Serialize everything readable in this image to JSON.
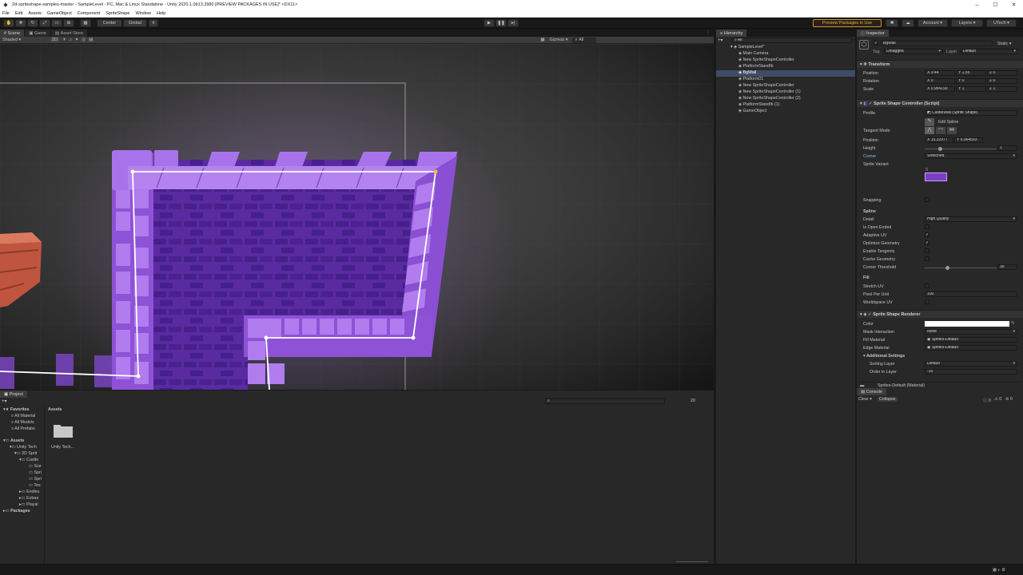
{
  "window": {
    "title": "2d-spriteshape-samples-master - SampleLevel - PC, Mac & Linux Standalone - Unity 2020.1.0b13.3980 [PREVIEW PACKAGES IN USE]* <DX11>",
    "controls": {
      "minimize": "–",
      "maximize": "☐",
      "close": "✕"
    }
  },
  "menu": [
    "File",
    "Edit",
    "Assets",
    "GameObject",
    "Component",
    "SpriteShape",
    "Window",
    "Help"
  ],
  "toolbar": {
    "center": "Center",
    "global": "Global",
    "preview_packages": "Preview Packages in Use",
    "account": "Account",
    "layers": "Layers",
    "layout": "UTech"
  },
  "scene_tabs": [
    "Scene",
    "Game",
    "Asset Store"
  ],
  "scene_bar": {
    "shading": "Shaded",
    "mode_2d": "2D",
    "gizmos": "Gizmos",
    "search": "All"
  },
  "hierarchy": {
    "tab": "Hierarchy",
    "search": "All",
    "items": [
      {
        "label": "SampleLevel*",
        "depth": 0
      },
      {
        "label": "Main Camera",
        "depth": 1
      },
      {
        "label": "New SpriteShapeController",
        "depth": 1
      },
      {
        "label": "PlatformStandfb",
        "depth": 1
      },
      {
        "label": "BgWall",
        "depth": 1,
        "selected": true
      },
      {
        "label": "Platform01",
        "depth": 1
      },
      {
        "label": "New SpriteShapeController",
        "depth": 1
      },
      {
        "label": "New SpriteShapeController (1)",
        "depth": 1
      },
      {
        "label": "New SpriteShapeController (2)",
        "depth": 1
      },
      {
        "label": "PlatformStandfb (1)",
        "depth": 1
      },
      {
        "label": "GameObject",
        "depth": 1
      }
    ]
  },
  "inspector": {
    "tab": "Inspector",
    "object_name": "BgWall",
    "static_label": "Static",
    "tag_label": "Tag",
    "tag_value": "Untagged",
    "layer_label": "Layer",
    "layer_value": "Default",
    "transform": {
      "title": "Transform",
      "position_label": "Position",
      "pos_x": "9.44",
      "pos_y": "1.55",
      "pos_z": "0",
      "rotation_label": "Rotation",
      "rot_x": "0",
      "rot_y": "0",
      "rot_z": "0",
      "scale_label": "Scale",
      "scale_x": "0.984190",
      "scale_y": "1",
      "scale_z": "1"
    },
    "sprite_shape_controller": {
      "title": "Sprite Shape Controller (Script)",
      "profile_label": "Profile",
      "profile_value": "CastleWall (Sprite Shape)",
      "edit_spline": "Edit Spline",
      "tangent_mode_label": "Tangent Mode",
      "position_label": "Position",
      "point_x": "15.32977",
      "point_y": "6.064593",
      "height_label": "Height",
      "height_value": "1",
      "corner_label": "Corner",
      "corner_value": "Stretched",
      "sprite_variant_label": "Sprite Variant",
      "sprite_variant_index": "0",
      "snapping_label": "Snapping",
      "spline_section": "Spline",
      "detail_label": "Detail",
      "detail_value": "High Quality",
      "is_open_ended_label": "Is Open Ended",
      "adaptive_uv_label": "Adaptive UV",
      "optimize_geometry_label": "Optimize Geometry",
      "enable_tangents_label": "Enable Tangents",
      "cache_geometry_label": "Cache Geometry",
      "corner_threshold_label": "Corner Threshold",
      "corner_threshold_value": "30",
      "fill_section": "Fill",
      "stretch_uv_label": "Stretch UV",
      "pixel_per_unit_label": "Pixel Per Unit",
      "pixel_per_unit_value": "100",
      "worldspace_uv_label": "Worldspace UV"
    },
    "sprite_shape_renderer": {
      "title": "Sprite Shape Renderer",
      "color_label": "Color",
      "mask_interaction_label": "Mask Interaction",
      "mask_interaction_value": "None",
      "fill_material_label": "Fill Material",
      "fill_material_value": "Sprites-Default",
      "edge_material_label": "Edge Material",
      "edge_material_value": "Sprites-Default",
      "additional_settings": "Additional Settings",
      "sorting_layer_label": "Sorting Layer",
      "sorting_layer_value": "Default",
      "order_in_layer_label": "Order in Layer",
      "order_in_layer_value": "-10"
    },
    "material_preview": "Sprites-Default (Material)"
  },
  "console": {
    "tab": "Console",
    "clear": "Clear",
    "collapse": "Collapse",
    "count_log": "0",
    "count_warn": "0",
    "count_err": "0"
  },
  "project": {
    "tab": "Project",
    "assets_header": "Assets",
    "folder_label": "Unity Tech...",
    "count": "20",
    "tree": [
      {
        "label": "Favorites",
        "depth": 0,
        "bold": true
      },
      {
        "label": "All Material",
        "depth": 1
      },
      {
        "label": "All Models",
        "depth": 1
      },
      {
        "label": "All Prefabs",
        "depth": 1
      },
      {
        "label": "Assets",
        "depth": 0,
        "bold": true
      },
      {
        "label": "Unity Tech",
        "depth": 1
      },
      {
        "label": "2D Sprit",
        "depth": 2
      },
      {
        "label": "Castle",
        "depth": 3
      },
      {
        "label": "Sce",
        "depth": 4
      },
      {
        "label": "Spri",
        "depth": 4
      },
      {
        "label": "Spri",
        "depth": 4
      },
      {
        "label": "Tex",
        "depth": 4
      },
      {
        "label": "Endles",
        "depth": 3
      },
      {
        "label": "Extras",
        "depth": 3
      },
      {
        "label": "Playal",
        "depth": 3
      },
      {
        "label": "Packages",
        "depth": 0,
        "bold": true
      }
    ]
  },
  "colors": {
    "wall_purple": "#7b3fc4",
    "wall_light": "#a56ee6",
    "accent_orange": "#c9902a",
    "selection_blue": "#3e4d66",
    "brick_red": "#c0553f"
  }
}
